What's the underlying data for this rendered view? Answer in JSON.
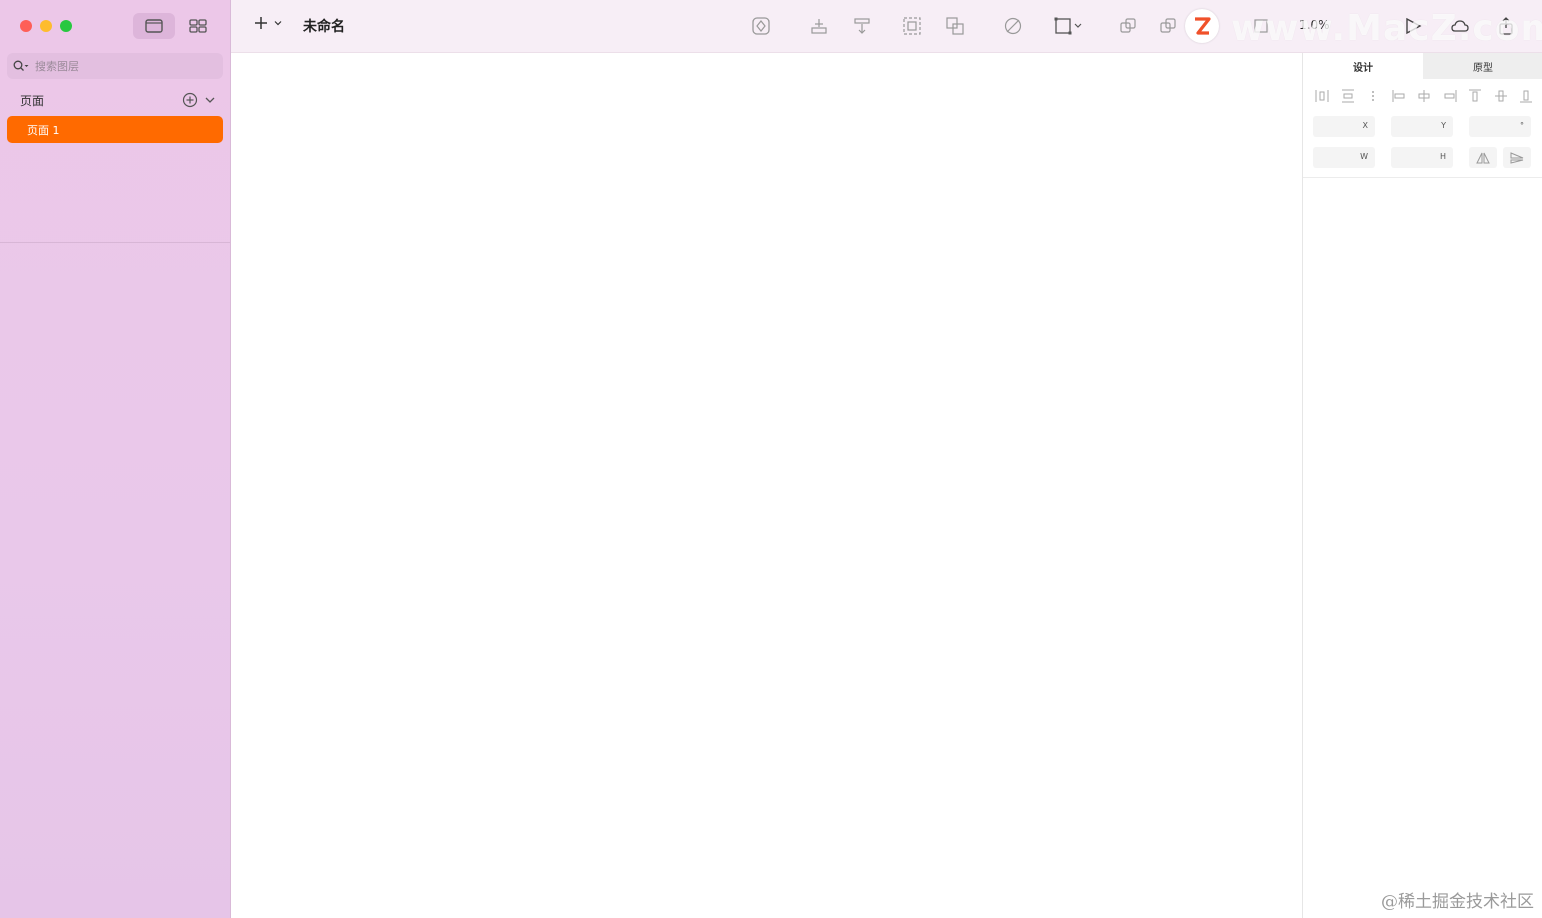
{
  "app": {
    "document_title": "未命名",
    "zoom": "1.0%"
  },
  "sidebar": {
    "search_placeholder": "搜索图层",
    "pages_title": "页面",
    "pages": [
      {
        "label": "页面 1",
        "selected": true
      }
    ]
  },
  "inspector": {
    "tabs": [
      {
        "label": "设计",
        "active": true
      },
      {
        "label": "原型",
        "active": false
      }
    ],
    "fields": {
      "x_label": "X",
      "y_label": "Y",
      "rotation_label": "°",
      "w_label": "W",
      "h_label": "H"
    }
  },
  "watermarks": {
    "site": "www.MacZ.com",
    "community": "@稀土掘金技术社区"
  },
  "colors": {
    "accent": "#ff6a00",
    "sidebar_bg": "#ecc7e8",
    "toolbar_bg": "#f7eef6"
  }
}
